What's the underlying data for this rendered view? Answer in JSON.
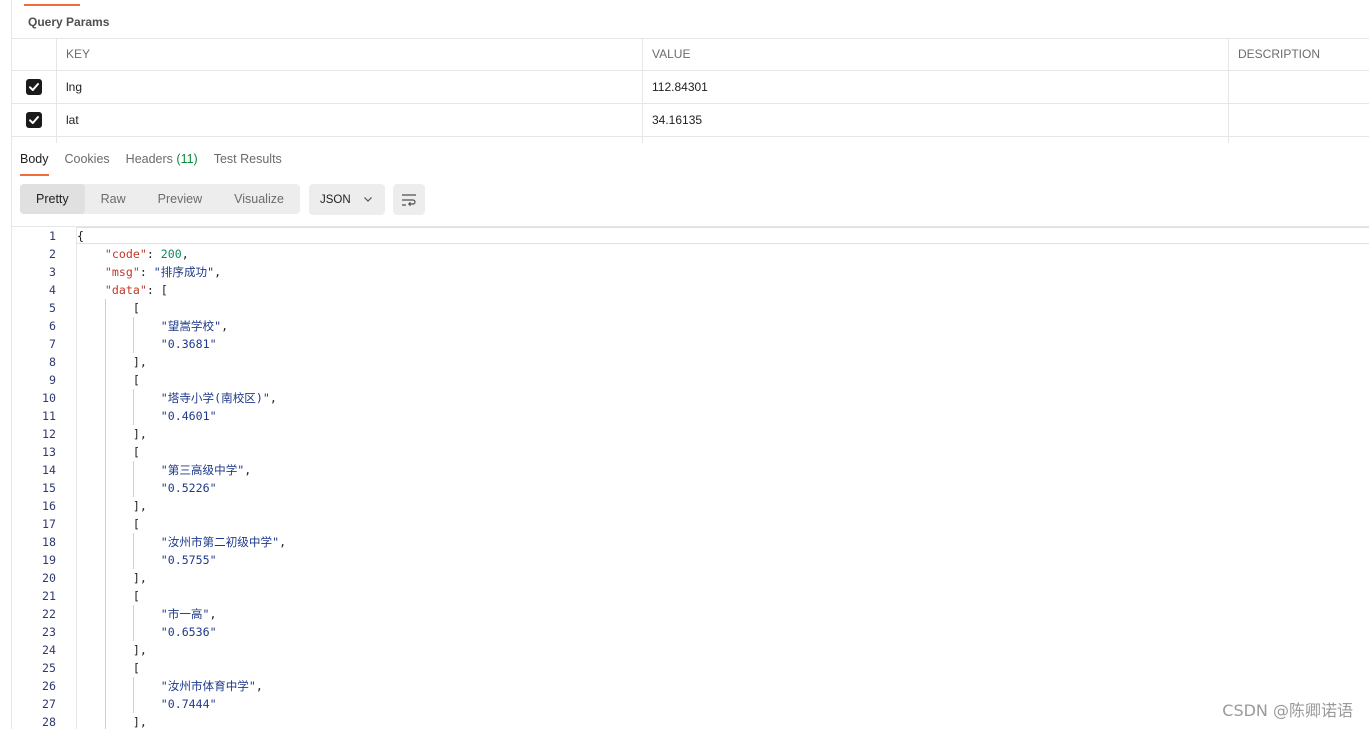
{
  "query_params": {
    "title": "Query Params",
    "headers": {
      "key": "KEY",
      "value": "VALUE",
      "description": "DESCRIPTION"
    },
    "rows": [
      {
        "checked": true,
        "key": "lng",
        "value": "112.84301",
        "description": ""
      },
      {
        "checked": true,
        "key": "lat",
        "value": "34.16135",
        "description": ""
      }
    ]
  },
  "response_tabs": {
    "body": "Body",
    "cookies": "Cookies",
    "headers": "Headers",
    "headers_count": "(11)",
    "test_results": "Test Results"
  },
  "view_modes": {
    "pretty": "Pretty",
    "raw": "Raw",
    "preview": "Preview",
    "visualize": "Visualize"
  },
  "format_select": {
    "value": "JSON"
  },
  "colors": {
    "accent": "#f26b3a",
    "json_key": "#c0392b",
    "json_string": "#1f3a8a",
    "json_number": "#0f8a5a",
    "count": "#0b8a3e"
  },
  "response_lines": [
    {
      "n": "1",
      "text": "{"
    },
    {
      "n": "2",
      "text": "    \"code\": 200,"
    },
    {
      "n": "3",
      "text": "    \"msg\": \"排序成功\","
    },
    {
      "n": "4",
      "text": "    \"data\": ["
    },
    {
      "n": "5",
      "text": "        ["
    },
    {
      "n": "6",
      "text": "            \"望嵩学校\","
    },
    {
      "n": "7",
      "text": "            \"0.3681\""
    },
    {
      "n": "8",
      "text": "        ],"
    },
    {
      "n": "9",
      "text": "        ["
    },
    {
      "n": "10",
      "text": "            \"塔寺小学(南校区)\","
    },
    {
      "n": "11",
      "text": "            \"0.4601\""
    },
    {
      "n": "12",
      "text": "        ],"
    },
    {
      "n": "13",
      "text": "        ["
    },
    {
      "n": "14",
      "text": "            \"第三高级中学\","
    },
    {
      "n": "15",
      "text": "            \"0.5226\""
    },
    {
      "n": "16",
      "text": "        ],"
    },
    {
      "n": "17",
      "text": "        ["
    },
    {
      "n": "18",
      "text": "            \"汝州市第二初级中学\","
    },
    {
      "n": "19",
      "text": "            \"0.5755\""
    },
    {
      "n": "20",
      "text": "        ],"
    },
    {
      "n": "21",
      "text": "        ["
    },
    {
      "n": "22",
      "text": "            \"市一高\","
    },
    {
      "n": "23",
      "text": "            \"0.6536\""
    },
    {
      "n": "24",
      "text": "        ],"
    },
    {
      "n": "25",
      "text": "        ["
    },
    {
      "n": "26",
      "text": "            \"汝州市体育中学\","
    },
    {
      "n": "27",
      "text": "            \"0.7444\""
    },
    {
      "n": "28",
      "text": "        ],"
    }
  ],
  "watermark": "CSDN @陈卿诺语"
}
